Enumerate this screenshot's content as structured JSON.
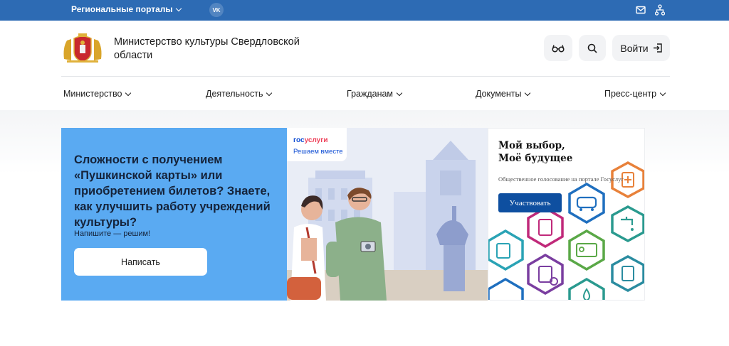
{
  "topbar": {
    "regional_label": "Региональные порталы",
    "vk_label": "VK"
  },
  "header": {
    "site_title": "Министерство культуры Свердловской области",
    "login_label": "Войти"
  },
  "nav": {
    "items": [
      {
        "label": "Министерство"
      },
      {
        "label": "Деятельность"
      },
      {
        "label": "Гражданам"
      },
      {
        "label": "Документы"
      },
      {
        "label": "Пресс-центр"
      }
    ]
  },
  "promo": {
    "heading": "Сложности с получением «Пушкинской карты» или приобретением билетов? Знаете, как улучшить работу учреждений культуры?",
    "subtext": "Напишите — решим!",
    "button_label": "Написать"
  },
  "gosuslugi": {
    "brand_part1": "гос",
    "brand_part2": "услуги",
    "tagline": "Решаем вместе"
  },
  "vote": {
    "title": "Мой выбор, Моё будущее",
    "description": "Общественное голосование на портале Госуслуг",
    "button_label": "Участвовать"
  },
  "colors": {
    "topbar": "#2d6bb4",
    "promo_bg": "#5aaaf2",
    "vote_button": "#0e4fa0"
  }
}
